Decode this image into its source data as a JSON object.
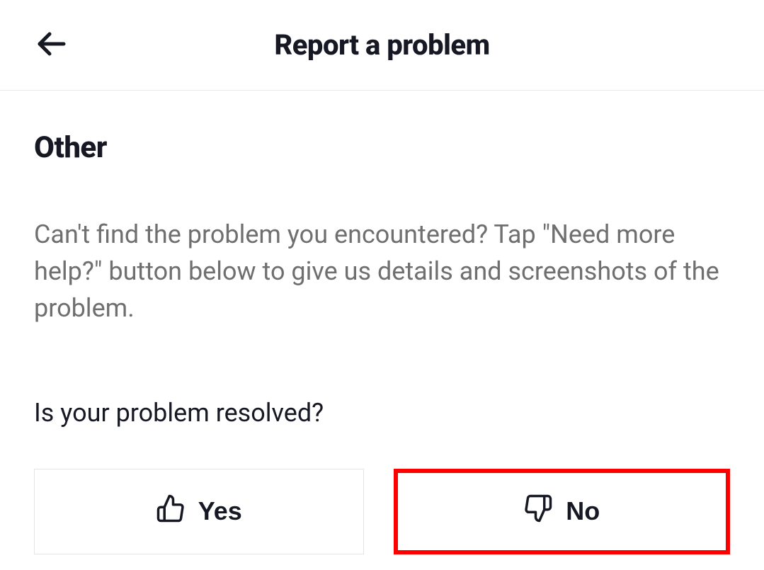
{
  "header": {
    "title": "Report a problem"
  },
  "main": {
    "section_heading": "Other",
    "description": "Can't find the problem you encountered? Tap \"Need more help?\" button below to give us details and screenshots of the problem.",
    "question": "Is your problem resolved?",
    "buttons": {
      "yes_label": "Yes",
      "no_label": "No"
    }
  }
}
